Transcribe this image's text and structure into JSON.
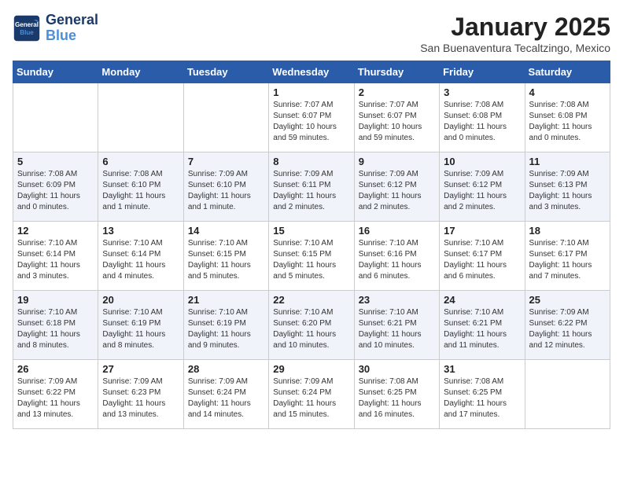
{
  "logo": {
    "line1": "General",
    "line2": "Blue"
  },
  "calendar": {
    "title": "January 2025",
    "subtitle": "San Buenaventura Tecaltzingo, Mexico"
  },
  "weekdays": [
    "Sunday",
    "Monday",
    "Tuesday",
    "Wednesday",
    "Thursday",
    "Friday",
    "Saturday"
  ],
  "weeks": [
    [
      {
        "day": "",
        "info": ""
      },
      {
        "day": "",
        "info": ""
      },
      {
        "day": "",
        "info": ""
      },
      {
        "day": "1",
        "info": "Sunrise: 7:07 AM\nSunset: 6:07 PM\nDaylight: 10 hours\nand 59 minutes."
      },
      {
        "day": "2",
        "info": "Sunrise: 7:07 AM\nSunset: 6:07 PM\nDaylight: 10 hours\nand 59 minutes."
      },
      {
        "day": "3",
        "info": "Sunrise: 7:08 AM\nSunset: 6:08 PM\nDaylight: 11 hours\nand 0 minutes."
      },
      {
        "day": "4",
        "info": "Sunrise: 7:08 AM\nSunset: 6:08 PM\nDaylight: 11 hours\nand 0 minutes."
      }
    ],
    [
      {
        "day": "5",
        "info": "Sunrise: 7:08 AM\nSunset: 6:09 PM\nDaylight: 11 hours\nand 0 minutes."
      },
      {
        "day": "6",
        "info": "Sunrise: 7:08 AM\nSunset: 6:10 PM\nDaylight: 11 hours\nand 1 minute."
      },
      {
        "day": "7",
        "info": "Sunrise: 7:09 AM\nSunset: 6:10 PM\nDaylight: 11 hours\nand 1 minute."
      },
      {
        "day": "8",
        "info": "Sunrise: 7:09 AM\nSunset: 6:11 PM\nDaylight: 11 hours\nand 2 minutes."
      },
      {
        "day": "9",
        "info": "Sunrise: 7:09 AM\nSunset: 6:12 PM\nDaylight: 11 hours\nand 2 minutes."
      },
      {
        "day": "10",
        "info": "Sunrise: 7:09 AM\nSunset: 6:12 PM\nDaylight: 11 hours\nand 2 minutes."
      },
      {
        "day": "11",
        "info": "Sunrise: 7:09 AM\nSunset: 6:13 PM\nDaylight: 11 hours\nand 3 minutes."
      }
    ],
    [
      {
        "day": "12",
        "info": "Sunrise: 7:10 AM\nSunset: 6:14 PM\nDaylight: 11 hours\nand 3 minutes."
      },
      {
        "day": "13",
        "info": "Sunrise: 7:10 AM\nSunset: 6:14 PM\nDaylight: 11 hours\nand 4 minutes."
      },
      {
        "day": "14",
        "info": "Sunrise: 7:10 AM\nSunset: 6:15 PM\nDaylight: 11 hours\nand 5 minutes."
      },
      {
        "day": "15",
        "info": "Sunrise: 7:10 AM\nSunset: 6:15 PM\nDaylight: 11 hours\nand 5 minutes."
      },
      {
        "day": "16",
        "info": "Sunrise: 7:10 AM\nSunset: 6:16 PM\nDaylight: 11 hours\nand 6 minutes."
      },
      {
        "day": "17",
        "info": "Sunrise: 7:10 AM\nSunset: 6:17 PM\nDaylight: 11 hours\nand 6 minutes."
      },
      {
        "day": "18",
        "info": "Sunrise: 7:10 AM\nSunset: 6:17 PM\nDaylight: 11 hours\nand 7 minutes."
      }
    ],
    [
      {
        "day": "19",
        "info": "Sunrise: 7:10 AM\nSunset: 6:18 PM\nDaylight: 11 hours\nand 8 minutes."
      },
      {
        "day": "20",
        "info": "Sunrise: 7:10 AM\nSunset: 6:19 PM\nDaylight: 11 hours\nand 8 minutes."
      },
      {
        "day": "21",
        "info": "Sunrise: 7:10 AM\nSunset: 6:19 PM\nDaylight: 11 hours\nand 9 minutes."
      },
      {
        "day": "22",
        "info": "Sunrise: 7:10 AM\nSunset: 6:20 PM\nDaylight: 11 hours\nand 10 minutes."
      },
      {
        "day": "23",
        "info": "Sunrise: 7:10 AM\nSunset: 6:21 PM\nDaylight: 11 hours\nand 10 minutes."
      },
      {
        "day": "24",
        "info": "Sunrise: 7:10 AM\nSunset: 6:21 PM\nDaylight: 11 hours\nand 11 minutes."
      },
      {
        "day": "25",
        "info": "Sunrise: 7:09 AM\nSunset: 6:22 PM\nDaylight: 11 hours\nand 12 minutes."
      }
    ],
    [
      {
        "day": "26",
        "info": "Sunrise: 7:09 AM\nSunset: 6:22 PM\nDaylight: 11 hours\nand 13 minutes."
      },
      {
        "day": "27",
        "info": "Sunrise: 7:09 AM\nSunset: 6:23 PM\nDaylight: 11 hours\nand 13 minutes."
      },
      {
        "day": "28",
        "info": "Sunrise: 7:09 AM\nSunset: 6:24 PM\nDaylight: 11 hours\nand 14 minutes."
      },
      {
        "day": "29",
        "info": "Sunrise: 7:09 AM\nSunset: 6:24 PM\nDaylight: 11 hours\nand 15 minutes."
      },
      {
        "day": "30",
        "info": "Sunrise: 7:08 AM\nSunset: 6:25 PM\nDaylight: 11 hours\nand 16 minutes."
      },
      {
        "day": "31",
        "info": "Sunrise: 7:08 AM\nSunset: 6:25 PM\nDaylight: 11 hours\nand 17 minutes."
      },
      {
        "day": "",
        "info": ""
      }
    ]
  ]
}
